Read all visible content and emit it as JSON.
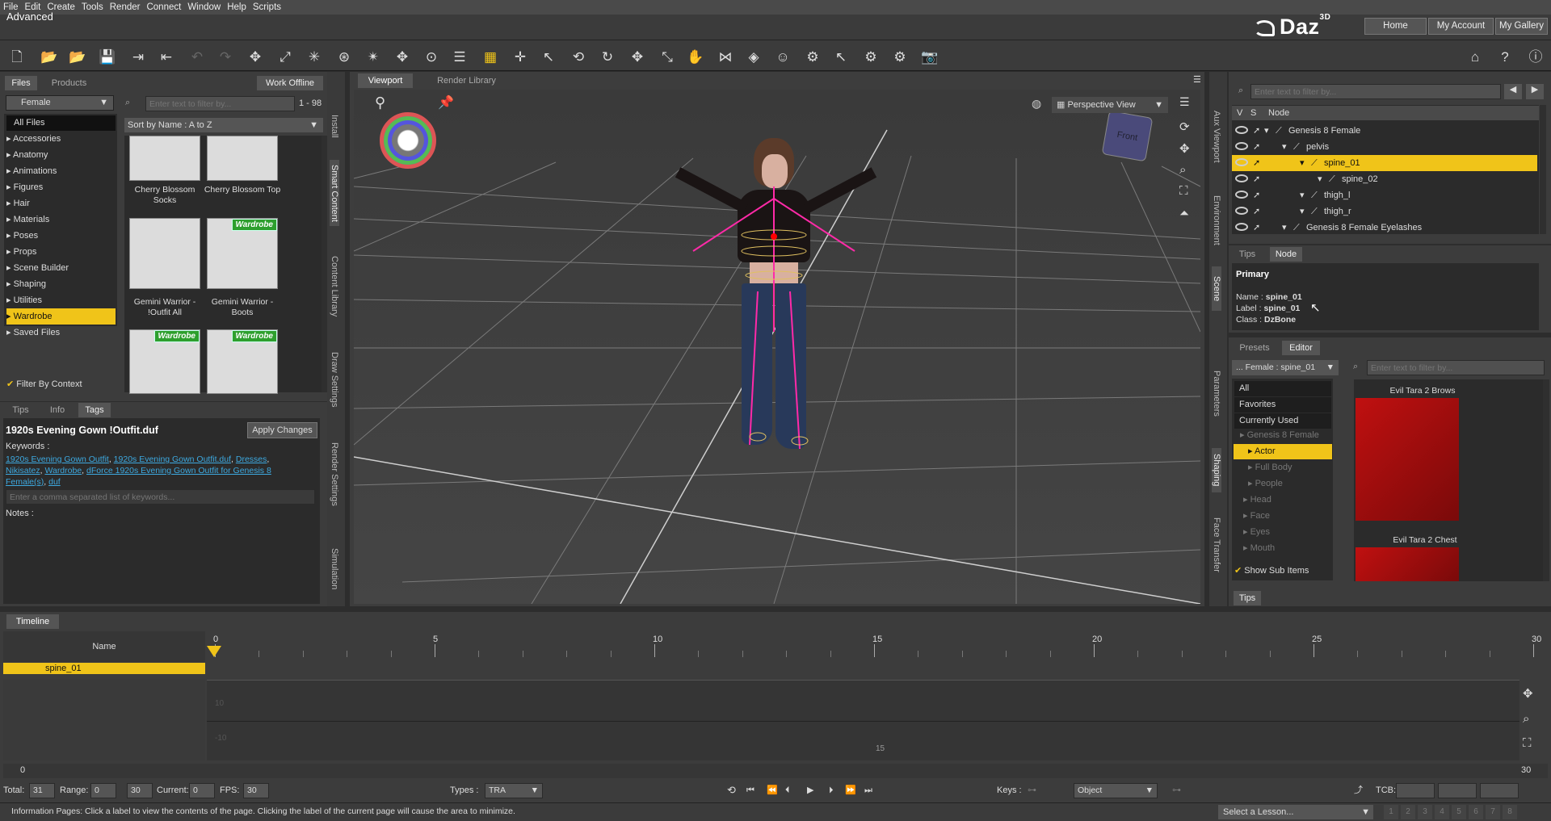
{
  "menu": [
    "File",
    "Edit",
    "Create",
    "Tools",
    "Render",
    "Connect",
    "Window",
    "Help",
    "Scripts"
  ],
  "window": {
    "title": "Advanced",
    "logo": "Daz",
    "logo_sup": "3D"
  },
  "top_buttons": [
    "Home",
    "My Account",
    "My Gallery"
  ],
  "left": {
    "tabs": [
      "Files",
      "Products"
    ],
    "work_offline": "Work Offline",
    "filter_select": "Female",
    "all_files": "All Files",
    "search_placeholder": "Enter text to filter by...",
    "count": "1 - 98",
    "sort": "Sort by Name : A to Z",
    "categories": [
      "Accessories",
      "Anatomy",
      "Animations",
      "Figures",
      "Hair",
      "Materials",
      "Poses",
      "Props",
      "Scene Builder",
      "Shaping",
      "Utilities",
      "Wardrobe",
      "Saved Files"
    ],
    "selected_category": "Wardrobe",
    "thumbs": [
      {
        "label": "Cherry Blossom Socks",
        "badge": ""
      },
      {
        "label": "Cherry Blossom Top",
        "badge": ""
      },
      {
        "label": "Gemini Warrior - !Outfit All",
        "badge": ""
      },
      {
        "label": "Gemini Warrior - Boots",
        "badge": "Wardrobe"
      },
      {
        "label": "",
        "badge": "Wardrobe"
      },
      {
        "label": "",
        "badge": "Wardrobe"
      }
    ],
    "filter_by_context": "Filter By Context",
    "vtabs": [
      "Install",
      "Smart Content",
      "Content Library",
      "Draw Settings",
      "Render Settings",
      "Simulation"
    ]
  },
  "tags": {
    "tabs": [
      "Tips",
      "Info",
      "Tags"
    ],
    "file": "1920s Evening Gown !Outfit.duf",
    "apply": "Apply Changes",
    "keywords_label": "Keywords :",
    "keywords": [
      "1920s Evening Gown Outfit",
      "1920s Evening Gown Outfit.duf",
      "Dresses",
      "Nikisatez",
      "Wardrobe",
      "dForce 1920s Evening Gown Outfit for Genesis 8 Female(s)",
      "duf"
    ],
    "kw_placeholder": "Enter a comma separated list of keywords...",
    "notes": "Notes :"
  },
  "viewport": {
    "tabs": [
      "Viewport",
      "Render Library"
    ],
    "view": "Perspective View",
    "cube": "Front"
  },
  "scene": {
    "search_placeholder": "Enter text to filter by...",
    "cols": [
      "V",
      "S",
      "Node"
    ],
    "rows": [
      {
        "name": "Genesis 8 Female",
        "indent": 0
      },
      {
        "name": "pelvis",
        "indent": 1
      },
      {
        "name": "spine_01",
        "indent": 2
      },
      {
        "name": "spine_02",
        "indent": 3
      },
      {
        "name": "thigh_l",
        "indent": 2
      },
      {
        "name": "thigh_r",
        "indent": 2
      },
      {
        "name": "Genesis 8 Female Eyelashes",
        "indent": 1
      }
    ],
    "selected": "spine_01",
    "vtabs": [
      "Aux Viewport",
      "Environment",
      "Scene",
      "Parameters",
      "Shaping",
      "Face Transfer"
    ]
  },
  "node": {
    "tabs": [
      "Tips",
      "Node"
    ],
    "primary": "Primary",
    "name_label": "Name :",
    "name": "spine_01",
    "label_label": "Label :",
    "label": "spine_01",
    "class_label": "Class :",
    "class": "DzBone"
  },
  "presets": {
    "tabs": [
      "Presets",
      "Editor"
    ],
    "select": "... Female : spine_01",
    "search_placeholder": "Enter text to filter by...",
    "list": [
      "All",
      "Favorites",
      "Currently Used"
    ],
    "tree": [
      "Genesis 8 Female",
      "Actor",
      "Full Body",
      "People",
      "Head",
      "Face",
      "Eyes",
      "Mouth"
    ],
    "show_sub": "Show Sub Items",
    "cards": [
      "Evil Tara 2 Brows",
      "Evil Tara 2 Chest"
    ],
    "tips": "Tips"
  },
  "timeline": {
    "tab": "Timeline",
    "name_col": "Name",
    "track": "spine_01",
    "ticks": [
      "0",
      "5",
      "10",
      "15",
      "20",
      "25",
      "30"
    ],
    "graph_labels": [
      "10",
      "-10",
      "15"
    ],
    "range_start": "0",
    "range_end": "30",
    "total_label": "Total:",
    "total": "31",
    "range_label": "Range:",
    "range_from": "0",
    "range_to": "30",
    "current_label": "Current:",
    "current": "0",
    "fps_label": "FPS:",
    "fps": "30",
    "types_label": "Types :",
    "types": "TRA",
    "keys_label": "Keys :",
    "object": "Object",
    "tcb": "TCB:"
  },
  "status": {
    "text": "Information Pages: Click a label to view the contents of the page. Clicking the label of the current page will cause the area to minimize.",
    "lesson": "Select a Lesson...",
    "pages": [
      "1",
      "2",
      "3",
      "4",
      "5",
      "6",
      "7",
      "8"
    ]
  }
}
